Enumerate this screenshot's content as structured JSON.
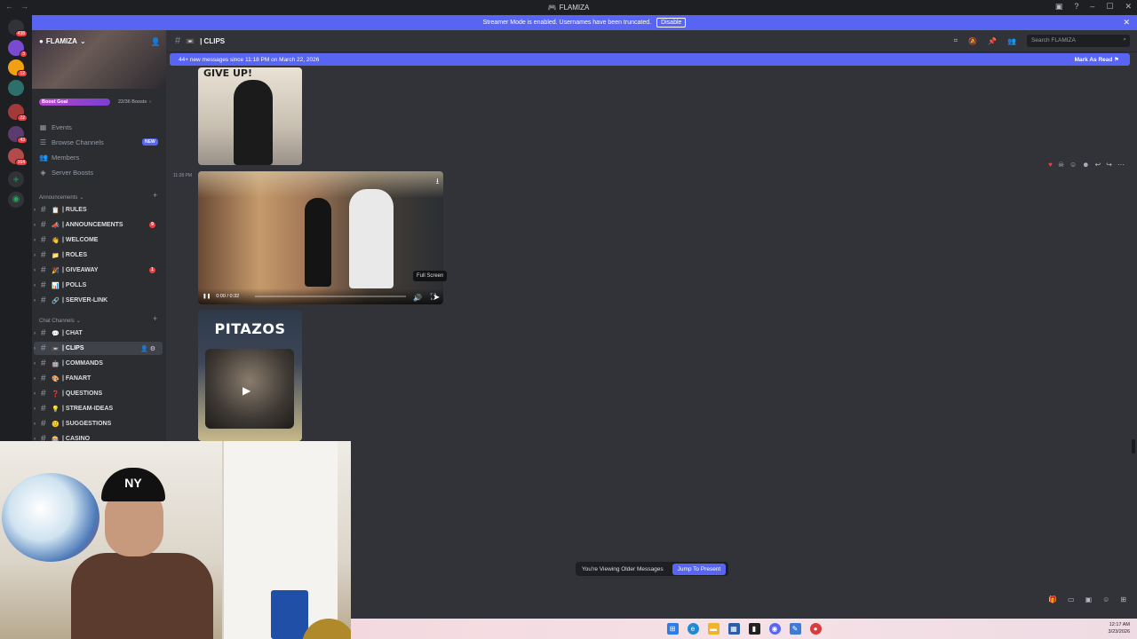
{
  "window": {
    "title": "FLAMIZA"
  },
  "streamer_banner": {
    "text": "Streamer Mode is enabled. Usernames have been truncated.",
    "disable_label": "Disable",
    "close": "✕"
  },
  "server_rail": {
    "badges": [
      "438",
      "3",
      "12",
      "",
      "22",
      "43",
      "164"
    ]
  },
  "server": {
    "name": "FLAMIZA",
    "boost_goal_label": "Boost Goal",
    "boost_count": "22/36 Boosts",
    "boost_progress": 0.611
  },
  "sidebar_links": [
    {
      "icon": "calendar-icon",
      "label": "Events"
    },
    {
      "icon": "browse-icon",
      "label": "Browse Channels",
      "badge": "NEW"
    },
    {
      "icon": "members-icon",
      "label": "Members"
    },
    {
      "icon": "boost-icon",
      "label": "Server Boosts"
    }
  ],
  "categories": [
    {
      "label": "Announcements",
      "channels": [
        {
          "emoji": "📋",
          "name": "| RULES"
        },
        {
          "emoji": "📣",
          "name": "| ANNOUNCEMENTS",
          "mention": "9"
        },
        {
          "emoji": "👋",
          "name": "| WELCOME"
        },
        {
          "emoji": "📁",
          "name": "| ROLES"
        },
        {
          "emoji": "🎉",
          "name": "| GIVEAWAY",
          "mention": "1"
        },
        {
          "emoji": "📊",
          "name": "| POLLS"
        },
        {
          "emoji": "🔗",
          "name": "| SERVER-LINK"
        }
      ]
    },
    {
      "label": "Chat Channels",
      "channels": [
        {
          "emoji": "💬",
          "name": "| CHAT"
        },
        {
          "emoji": "📼",
          "name": "| CLIPS",
          "active": true
        },
        {
          "emoji": "🤖",
          "name": "| COMMANDS"
        },
        {
          "emoji": "🎨",
          "name": "| FANART"
        },
        {
          "emoji": "❓",
          "name": "| QUESTIONS"
        },
        {
          "emoji": "💡",
          "name": "| STREAM-IDEAS"
        },
        {
          "emoji": "🙂",
          "name": "| SUGGESTIONS"
        },
        {
          "emoji": "🎰",
          "name": "| CASINO"
        }
      ]
    }
  ],
  "channel_header": {
    "name": "| CLIPS",
    "search_placeholder": "Search FLAMIZA"
  },
  "new_messages_bar": {
    "text": "44+ new messages since 11:18 PM on March 22, 2026",
    "mark_read": "Mark As Read"
  },
  "messages": {
    "clip1_top_text": "GIVE UP!",
    "video_timestamp": "11:28 PM",
    "video_time": "0:00 / 0:32",
    "video_progress": 0.0,
    "tooltip": "Full Screen",
    "clip2_title": "PITAZOS"
  },
  "older_messages": {
    "text": "You're Viewing Older Messages",
    "jump_label": "Jump To Present"
  },
  "clock": {
    "time": "12:17 AM",
    "date": "3/23/2026"
  },
  "colors": {
    "accent": "#5865f2",
    "mention": "#f23f43",
    "sidebar": "#2b2d31",
    "main": "#313338"
  }
}
